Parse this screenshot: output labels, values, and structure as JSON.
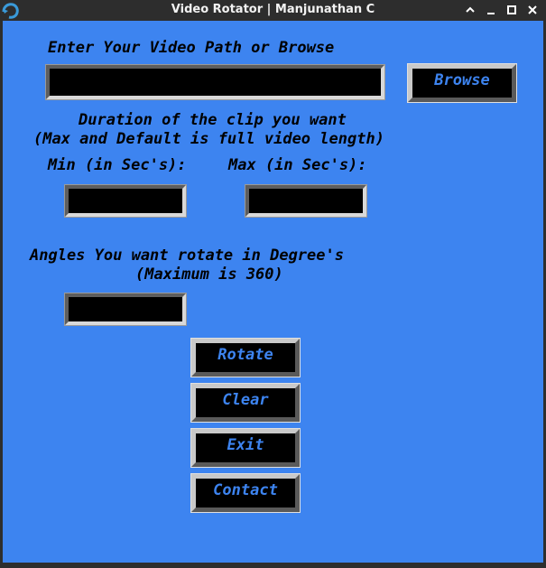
{
  "window": {
    "title": "Video Rotator | Manjunathan C",
    "controls": {
      "minimize": "⌄",
      "maximize": "⌃",
      "restore": "□",
      "close": "✕"
    }
  },
  "form": {
    "path_label": "Enter Your Video Path or Browse",
    "path_value": "",
    "browse_label": "Browse",
    "duration_line1": "Duration of the clip you want",
    "duration_line2": "(Max and Default is full video length)",
    "min_label": "Min (in Sec's):",
    "max_label": "Max (in Sec's):",
    "min_value": "",
    "max_value": "",
    "angle_line1": "Angles You want rotate in Degree's",
    "angle_line2": "(Maximum is 360)",
    "angle_value": ""
  },
  "actions": {
    "rotate": "Rotate",
    "clear": "Clear",
    "exit": "Exit",
    "contact": "Contact"
  },
  "colors": {
    "background": "#3d84f0",
    "titlebar": "#2d2d2d",
    "field": "#000000",
    "button_text": "#3d84f0"
  }
}
